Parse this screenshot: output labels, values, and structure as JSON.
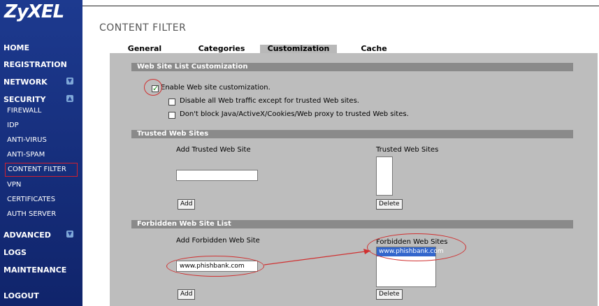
{
  "brand": "ZyXEL",
  "page_title": "CONTENT FILTER",
  "colors": {
    "sidebar": "#1d3a8f",
    "panel": "#bdbdbd",
    "section_bar": "#8a8a8a",
    "annotation": "#d03030"
  },
  "sidebar": {
    "home": "HOME",
    "registration": "REGISTRATION",
    "network": "NETWORK",
    "security": "SECURITY",
    "firewall": "FIREWALL",
    "idp": "IDP",
    "anti_virus": "ANTI-VIRUS",
    "anti_spam": "ANTI-SPAM",
    "content_filter": "CONTENT FILTER",
    "vpn": "VPN",
    "certificates": "CERTIFICATES",
    "auth_server": "AUTH SERVER",
    "advanced": "ADVANCED",
    "logs": "LOGS",
    "maintenance": "MAINTENANCE",
    "logout": "LOGOUT"
  },
  "tabs": [
    "General",
    "Categories",
    "Customization",
    "Cache"
  ],
  "customization": {
    "header": "Web Site List Customization",
    "enable_label": "Enable Web site customization.",
    "enable_checked": true,
    "disable_label": "Disable all Web traffic except for trusted Web sites.",
    "disable_checked": false,
    "dont_block_label": "Don't block Java/ActiveX/Cookies/Web proxy to trusted Web sites.",
    "dont_block_checked": false
  },
  "trusted": {
    "header": "Trusted Web Sites",
    "add_label": "Add Trusted Web Site",
    "input_value": "",
    "list_label": "Trusted Web Sites",
    "list_items": [],
    "add_button": "Add",
    "delete_button": "Delete"
  },
  "forbidden": {
    "header": "Forbidden Web Site List",
    "add_label": "Add Forbidden Web Site",
    "input_value": "www.phishbank.com",
    "list_label": "Forbidden Web Sites",
    "list_items": [
      "www.phishbank.com"
    ],
    "add_button": "Add",
    "delete_button": "Delete"
  }
}
